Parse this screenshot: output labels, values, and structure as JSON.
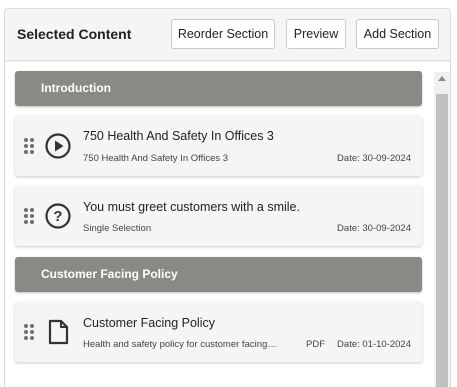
{
  "header": {
    "title": "Selected Content",
    "reorder_label": "Reorder Section",
    "preview_label": "Preview",
    "add_label": "Add Section"
  },
  "sections": [
    {
      "title": "Introduction",
      "items": [
        {
          "icon": "play-circle-icon",
          "title": "750 Health And Safety In Offices 3",
          "subtitle": "750 Health And Safety In Offices 3",
          "type": "",
          "date": "Date: 30-09-2024"
        },
        {
          "icon": "question-circle-icon",
          "title": "You must greet customers with a smile.",
          "subtitle": "Single Selection",
          "type": "",
          "date": "Date: 30-09-2024"
        }
      ]
    },
    {
      "title": "Customer Facing Policy",
      "items": [
        {
          "icon": "document-icon",
          "title": "Customer Facing Policy",
          "subtitle": "Health and safety policy for customer facing…",
          "type": "PDF",
          "date": "Date: 01-10-2024"
        }
      ]
    }
  ]
}
